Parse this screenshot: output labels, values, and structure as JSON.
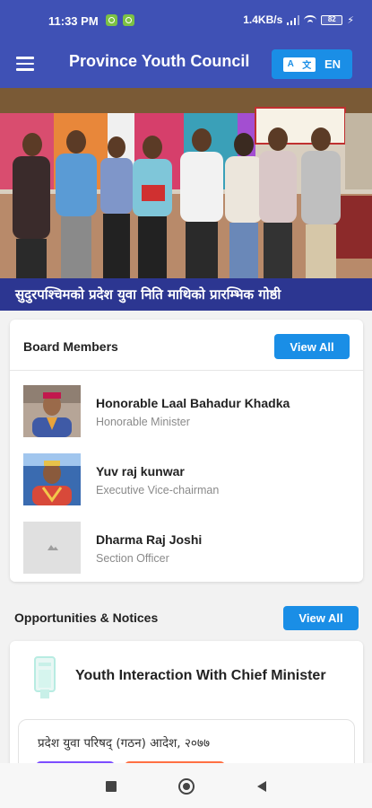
{
  "status_bar": {
    "time": "11:33 PM",
    "network_speed": "1.4KB/s",
    "battery": "82"
  },
  "app_bar": {
    "title": "Province Youth Council",
    "language_button": "EN",
    "icons": [
      "menu-icon",
      "translate-icon"
    ]
  },
  "banner": {
    "caption": "सुदुरपश्चिमको प्रदेश युवा निति माथिको प्रारम्भिक गोष्ठी"
  },
  "board_members": {
    "title": "Board Members",
    "view_all": "View All",
    "members": [
      {
        "name": "Honorable Laal Bahadur Khadka",
        "role": "Honorable Minister"
      },
      {
        "name": "Yuv raj kunwar",
        "role": "Executive Vice-chairman"
      },
      {
        "name": "Dharma Raj Joshi",
        "role": "Section Officer"
      }
    ]
  },
  "opportunities": {
    "title": "Opportunities & Notices",
    "view_all": "View All",
    "featured": "Youth Interaction With Chief Minister",
    "notice": "प्रदेश युवा परिषद् (गठन) आदेश, २०७७"
  },
  "colors": {
    "primary": "#3f51b5",
    "accent_button": "#1a8ee6",
    "banner_caption_bg": "#2c3691",
    "chip_purple": "#7c4dff",
    "chip_orange": "#ff7043"
  }
}
